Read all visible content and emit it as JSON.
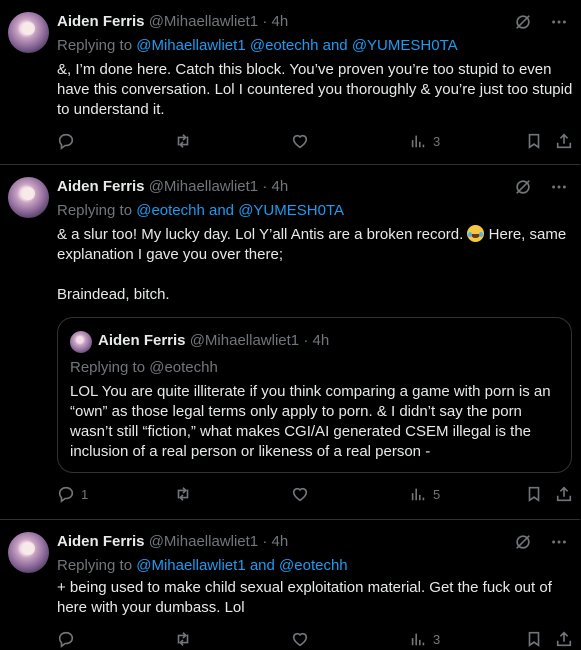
{
  "tweets": [
    {
      "name": "Aiden Ferris",
      "handle": "@Mihaellawliet1",
      "dot": "·",
      "time": "4h",
      "reply_prefix": "Replying to",
      "reply_to_1": "@Mihaellawliet1",
      "reply_to_2": "@eotechh",
      "reply_and": "and",
      "reply_to_3": "@YUMESH0TA",
      "text": "&, I’m done here. Catch this block. You’ve proven you’re too stupid to even have this conversation. Lol I countered you thoroughly & you’re just too stupid to understand it.",
      "replies": "",
      "views": "3"
    },
    {
      "name": "Aiden Ferris",
      "handle": "@Mihaellawliet1",
      "dot": "·",
      "time": "4h",
      "reply_prefix": "Replying to",
      "reply_to_1": "@eotechh",
      "reply_and": "and",
      "reply_to_2": "@YUMESH0TA",
      "text_a": "& a slur too! My lucky day. Lol Y’all Antis are a broken record.",
      "text_b": "Here, same explanation I gave you over there;",
      "text_c": "Braindead, bitch.",
      "emoji": "face-with-tears-of-joy",
      "quote": {
        "name": "Aiden Ferris",
        "handle": "@Mihaellawliet1",
        "dot": "·",
        "time": "4h",
        "reply": "Replying to @eotechh",
        "text": "LOL You are quite illiterate if you think comparing a game with porn is an “own” as those legal terms only apply to porn. & I didn’t say the porn wasn’t still “fiction,” what makes CGI/AI generated CSEM illegal is the inclusion of a real person or likeness of a real person -"
      },
      "replies": "1",
      "views": "5"
    },
    {
      "name": "Aiden Ferris",
      "handle": "@Mihaellawliet1",
      "dot": "·",
      "time": "4h",
      "reply_prefix": "Replying to",
      "reply_to_1": "@Mihaellawliet1",
      "reply_and": "and",
      "reply_to_2": "@eotechh",
      "text": "+ being used to make child sexual exploitation material. Get the fuck out of here with your dumbass. Lol",
      "replies": "",
      "views": "3"
    }
  ],
  "icons": {
    "grok": "grok-icon",
    "more": "more-icon",
    "reply": "reply-icon",
    "retweet": "retweet-icon",
    "like": "like-icon",
    "views": "views-icon",
    "bookmark": "bookmark-icon",
    "share": "share-icon"
  },
  "colors": {
    "link": "#1d9bf0",
    "muted": "#71767b",
    "text": "#e7e9ea",
    "border": "#2f3336",
    "bg": "#000000"
  }
}
